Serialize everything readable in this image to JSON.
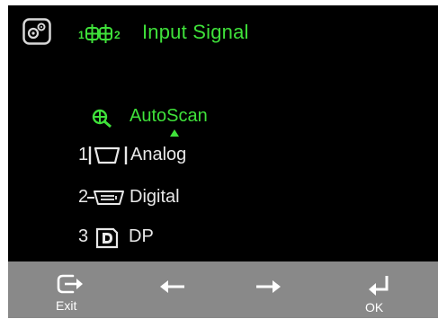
{
  "title": "Input Signal",
  "menu": {
    "autoscan": "AutoScan",
    "analog": {
      "number": "1",
      "label": "Analog"
    },
    "digital": {
      "number": "2",
      "label": "Digital"
    },
    "dp": {
      "number": "3",
      "label": "DP"
    }
  },
  "footer": {
    "exit_label": "Exit",
    "ok_label": "OK"
  },
  "icons": {
    "settings": "settings-icon",
    "input": "input-signal-icon",
    "autoscan": "autoscan-icon",
    "analog": "vga-connector-icon",
    "digital": "dvi-connector-icon",
    "dp": "displayport-icon",
    "exit": "exit-icon",
    "left": "arrow-left-icon",
    "right": "arrow-right-icon",
    "ok": "enter-icon"
  },
  "colors": {
    "background": "#000000",
    "accent": "#3fe13a",
    "text": "#e8e8e8",
    "footer": "#898989"
  }
}
